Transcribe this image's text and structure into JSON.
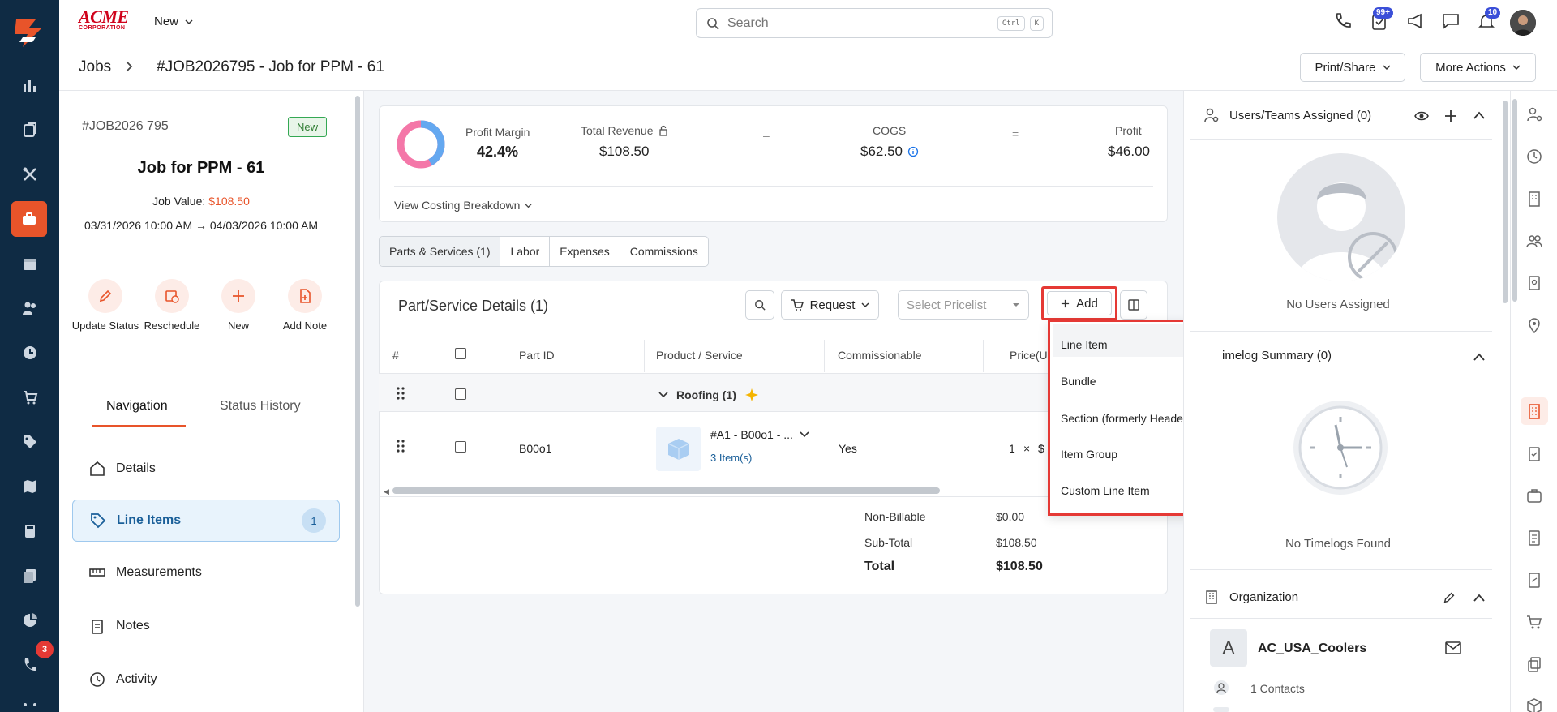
{
  "top": {
    "new_label": "New",
    "search_placeholder": "Search",
    "kbd1": "Ctrl",
    "kbd2": "K",
    "badge_tasks": "99+",
    "badge_notifications": "10",
    "brand_line1": "ACME",
    "brand_line2": "CORPORATION"
  },
  "nav": {
    "badge_count": "3"
  },
  "breadcrumb": {
    "jobs": "Jobs",
    "title": "#JOB2026795 - Job for PPM - 61",
    "print_share": "Print/Share",
    "more_actions": "More Actions"
  },
  "job": {
    "number": "#JOB2026 795",
    "status": "New",
    "title": "Job for PPM - 61",
    "value_label": "Job Value:",
    "value": "$108.50",
    "dates": "03/31/2026 10:00 AM → 04/03/2026 10:00 AM",
    "actions": [
      "Update Status",
      "Reschedule",
      "New",
      "Add Note"
    ]
  },
  "leftnav_tabs": {
    "navigation": "Navigation",
    "status_history": "Status History"
  },
  "left_items": [
    {
      "label": "Details"
    },
    {
      "label": "Line Items",
      "count": "1"
    },
    {
      "label": "Measurements"
    },
    {
      "label": "Notes"
    },
    {
      "label": "Activity"
    }
  ],
  "kpi": {
    "profit_margin_label": "Profit Margin",
    "profit_margin": "42.4%",
    "profit_margin_fraction": 0.424,
    "revenue_label": "Total Revenue",
    "revenue": "$108.50",
    "minus": "–",
    "cogs_label": "COGS",
    "cogs": "$62.50",
    "equals": "=",
    "profit_label": "Profit",
    "profit": "$46.00",
    "breakdown": "View Costing Breakdown"
  },
  "subtabs": [
    "Parts & Services (1)",
    "Labor",
    "Expenses",
    "Commissions"
  ],
  "parts": {
    "title": "Part/Service Details (1)",
    "request": "Request",
    "pricelist_placeholder": "Select Pricelist",
    "add": "Add",
    "headers": [
      "#",
      "Part ID",
      "Product / Service",
      "Commissionable",
      "Price(U"
    ],
    "group": "Roofing (1)",
    "row": {
      "part_id": "B00o1",
      "product": "#A1 - B00o1 - ...",
      "items": "3 Item(s)",
      "commissionable": "Yes",
      "qty": "1",
      "times": "×",
      "price": "$"
    },
    "summary": [
      {
        "label": "Non-Billable",
        "value": "$0.00"
      },
      {
        "label": "Sub-Total",
        "value": "$108.50"
      },
      {
        "label": "Total",
        "value": "$108.50"
      }
    ]
  },
  "add_menu": [
    "Line Item",
    "Bundle",
    "Section (formerly Header)",
    "Item Group",
    "Custom Line Item"
  ],
  "right": {
    "users_title": "Users/Teams Assigned (0)",
    "no_users": "No Users Assigned",
    "timelog_title": "imelog Summary (0)",
    "no_timelogs": "No Timelogs Found",
    "org_title": "Organization",
    "org_initial": "A",
    "org_name": "AC_USA_Coolers",
    "contacts": "1 Contacts"
  },
  "colors": {
    "accent": "#e8542a",
    "nav_bg": "#0f2b44",
    "highlight_red": "#e53935",
    "link": "#1a5f99"
  }
}
